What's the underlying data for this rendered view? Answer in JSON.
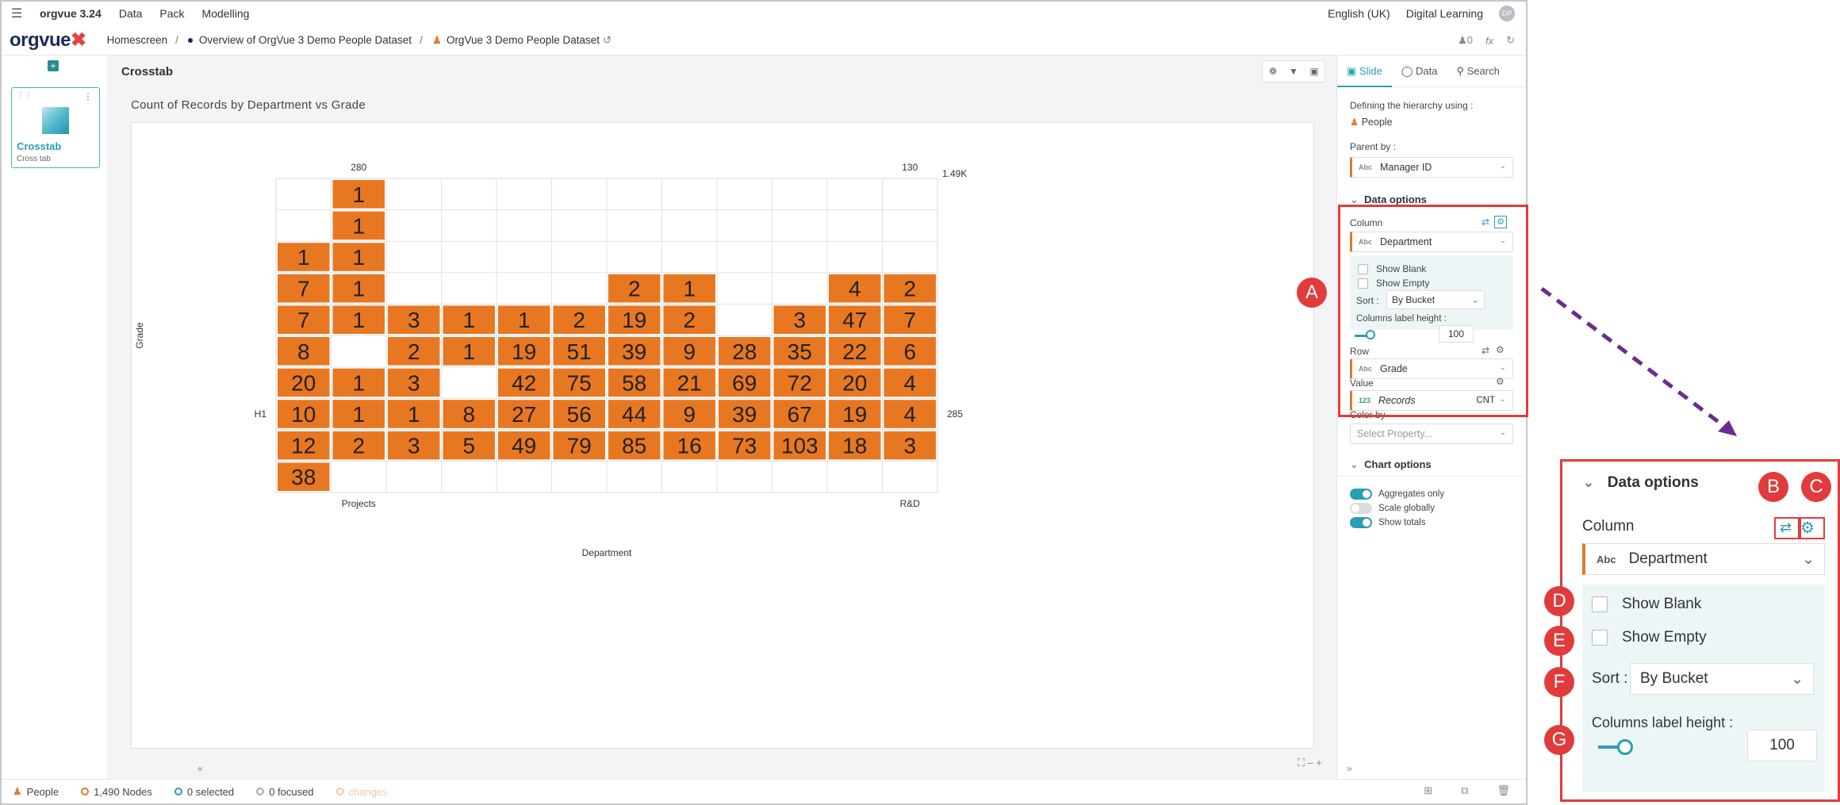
{
  "app": {
    "name": "orgvue 3.24",
    "menu": [
      "Data",
      "Pack",
      "Modelling"
    ],
    "language": "English (UK)",
    "workspace": "Digital Learning",
    "user_initials": "DP"
  },
  "breadcrumb": {
    "home": "Homescreen",
    "overview": "Overview of OrgVue 3 Demo People Dataset",
    "dataset": "OrgVue 3 Demo People Dataset",
    "people_count_icon": "0",
    "fx_label": "fx"
  },
  "logo": {
    "text": "orgvue"
  },
  "slide": {
    "title": "Crosstab",
    "subtitle": "Cross tab"
  },
  "canvas": {
    "title": "Crosstab"
  },
  "chart_data": {
    "type": "heatmap",
    "title": "Count of Records by Department vs Grade",
    "xlabel": "Department",
    "ylabel": "Grade",
    "top_labels": [
      {
        "col": 1,
        "text": "280"
      },
      {
        "col": 11,
        "text": "130"
      }
    ],
    "bottom_labels": [
      {
        "col": 1,
        "text": "Projects"
      },
      {
        "col": 11,
        "text": "R&D"
      }
    ],
    "left_label": {
      "row": 7,
      "text": "H1"
    },
    "right_label": {
      "row": 7,
      "text": "285"
    },
    "corner_total": "1.49K",
    "columns": 12,
    "rows": [
      [
        null,
        1,
        null,
        null,
        null,
        null,
        null,
        null,
        null,
        null,
        null,
        null
      ],
      [
        null,
        1,
        null,
        null,
        null,
        null,
        null,
        null,
        null,
        null,
        null,
        null
      ],
      [
        1,
        1,
        null,
        null,
        null,
        null,
        null,
        null,
        null,
        null,
        null,
        null
      ],
      [
        7,
        1,
        null,
        null,
        null,
        null,
        2,
        1,
        null,
        null,
        4,
        2
      ],
      [
        7,
        1,
        3,
        1,
        1,
        2,
        19,
        2,
        null,
        3,
        47,
        7
      ],
      [
        8,
        null,
        2,
        1,
        19,
        51,
        39,
        9,
        28,
        35,
        22,
        6
      ],
      [
        20,
        1,
        3,
        null,
        42,
        75,
        58,
        21,
        69,
        72,
        20,
        4
      ],
      [
        10,
        1,
        1,
        8,
        27,
        56,
        44,
        9,
        39,
        67,
        19,
        4
      ],
      [
        12,
        2,
        3,
        5,
        49,
        79,
        85,
        16,
        73,
        103,
        18,
        3
      ],
      [
        38,
        null,
        null,
        null,
        null,
        null,
        null,
        null,
        null,
        null,
        null,
        null
      ]
    ],
    "cell_color": "#e87722",
    "grid": true
  },
  "panel": {
    "tabs": [
      "Slide",
      "Data",
      "Search"
    ],
    "hierarchy_label": "Defining the hierarchy using :",
    "hierarchy_value": "People",
    "parent_label": "Parent by :",
    "parent_value": "Manager ID",
    "data_options": "Data options",
    "column_label": "Column",
    "column_value": "Department",
    "show_blank": "Show Blank",
    "show_empty": "Show Empty",
    "sort_label": "Sort :",
    "sort_value": "By Bucket",
    "label_height_label": "Columns label height :",
    "label_height_value": "100",
    "row_label": "Row",
    "row_value": "Grade",
    "value_label": "Value",
    "value_value": "Records",
    "value_agg": "CNT",
    "color_by_label": "Color by",
    "color_by_placeholder": "Select Property...",
    "chart_options": "Chart options",
    "toggles": [
      {
        "label": "Aggregates only",
        "on": true
      },
      {
        "label": "Scale globally",
        "on": false
      },
      {
        "label": "Show totals",
        "on": true
      }
    ],
    "abc": "Abc",
    "num": "123"
  },
  "status": {
    "people": "People",
    "nodes": "1,490 Nodes",
    "selected": "0 selected",
    "focused": "0 focused",
    "changes": "changes"
  },
  "markers": [
    "A",
    "B",
    "C",
    "D",
    "E",
    "F",
    "G"
  ],
  "accent_color": "#2a9eb2",
  "annotation_color": "#e23b3b",
  "arrow_color": "#6b2c8f"
}
